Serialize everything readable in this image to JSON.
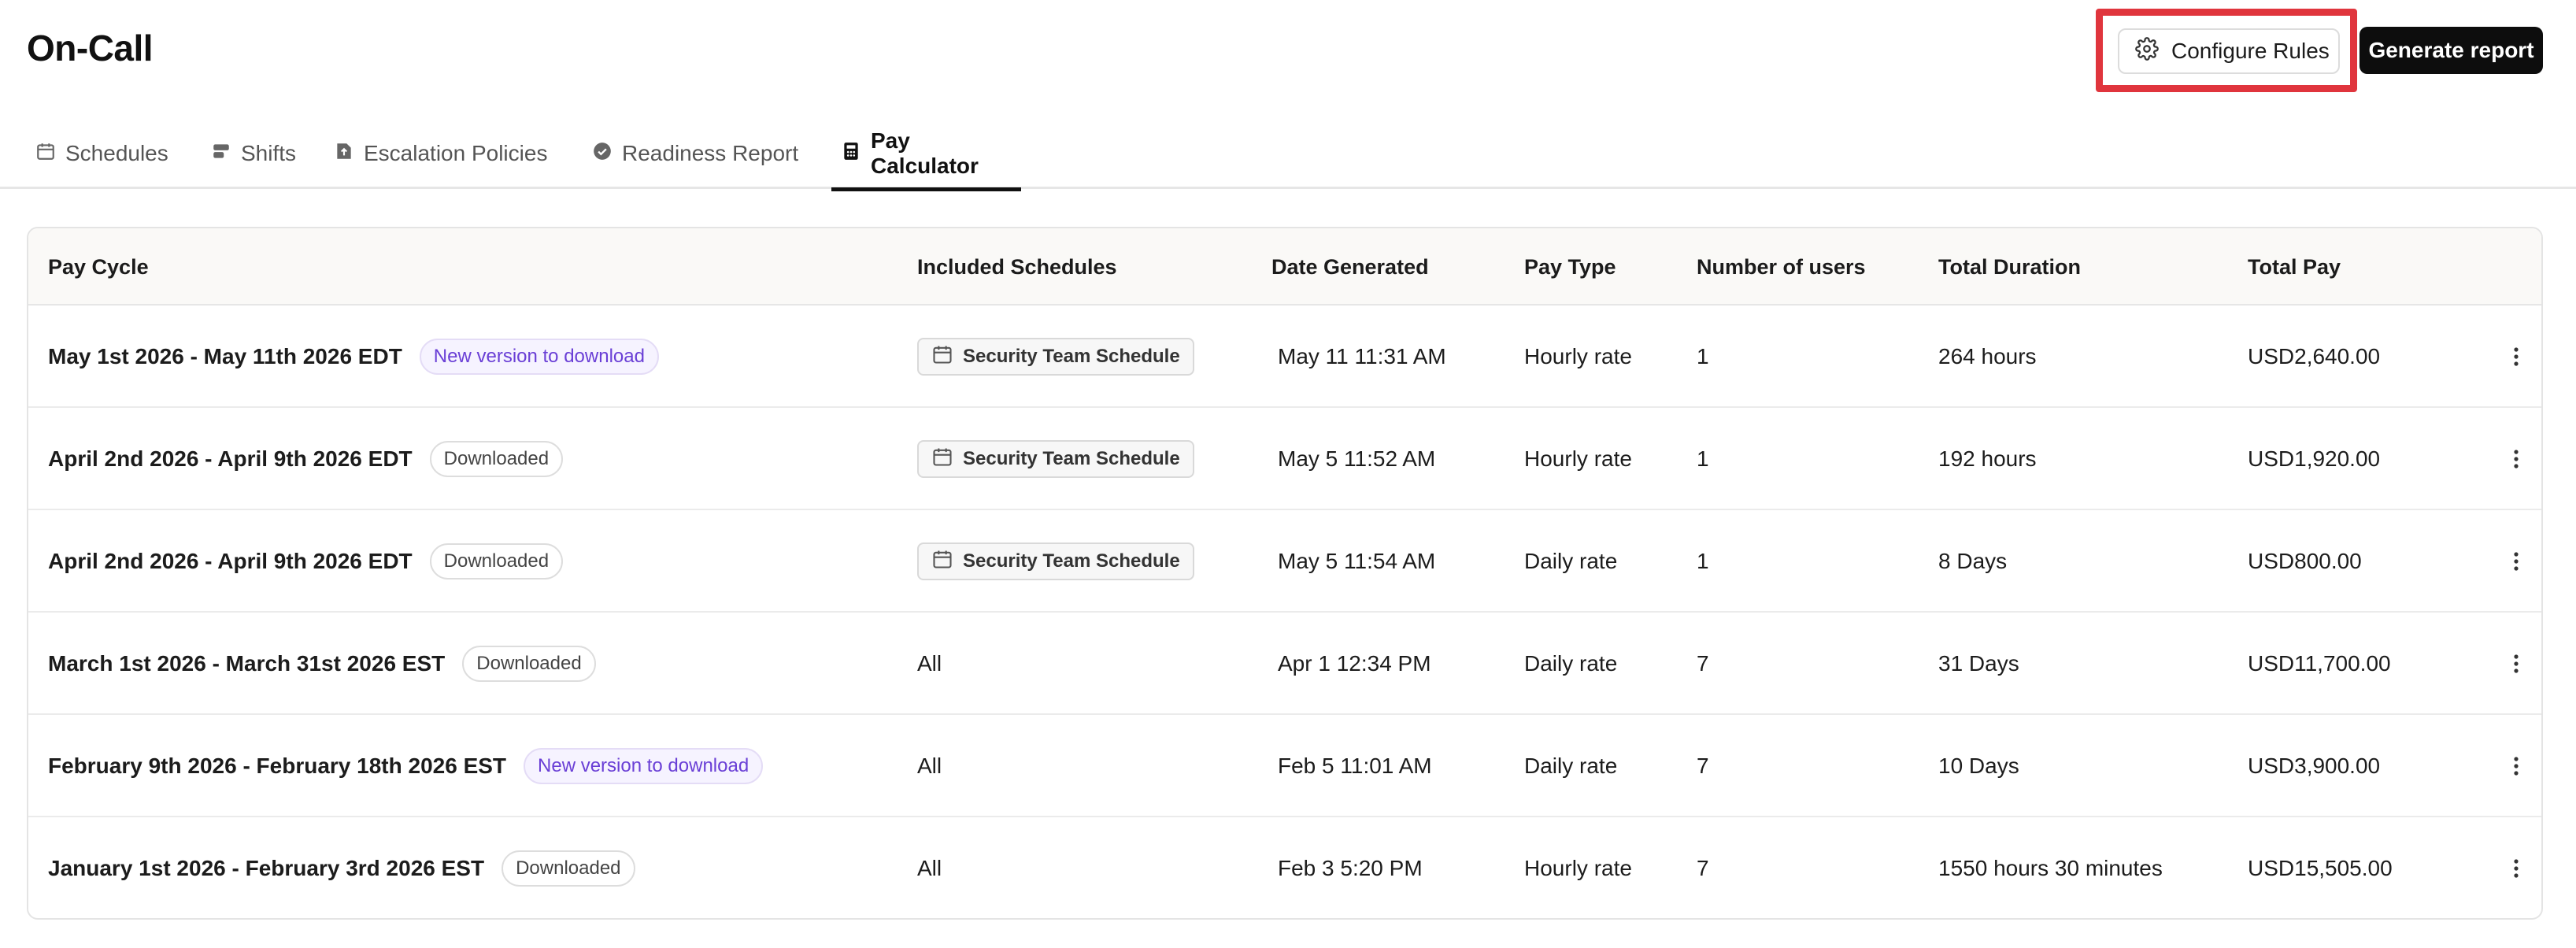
{
  "header": {
    "title": "On-Call",
    "configure_label": "Configure Rules",
    "generate_label": "Generate report"
  },
  "tabs": [
    {
      "label": "Schedules",
      "icon": "calendar-icon"
    },
    {
      "label": "Shifts",
      "icon": "shifts-icon"
    },
    {
      "label": "Escalation Policies",
      "icon": "escalation-icon"
    },
    {
      "label": "Readiness Report",
      "icon": "check-circle-icon"
    },
    {
      "label": "Pay Calculator",
      "icon": "calculator-icon",
      "active": true
    }
  ],
  "table": {
    "columns": [
      "Pay Cycle",
      "Included Schedules",
      "Date Generated",
      "Pay Type",
      "Number of users",
      "Total Duration",
      "Total Pay"
    ],
    "rows": [
      {
        "cycle": "May 1st 2026 - May 11th 2026 EDT",
        "badge": "New version to download",
        "badge_type": "new",
        "schedule": "Security Team Schedule",
        "date": "May 11 11:31 AM",
        "pay_type": "Hourly rate",
        "users": "1",
        "duration": "264 hours",
        "total": "USD2,640.00"
      },
      {
        "cycle": "April 2nd 2026 - April 9th 2026 EDT",
        "badge": "Downloaded",
        "badge_type": "dl",
        "schedule": "Security Team Schedule",
        "date": "May 5 11:52 AM",
        "pay_type": "Hourly rate",
        "users": "1",
        "duration": "192 hours",
        "total": "USD1,920.00"
      },
      {
        "cycle": "April 2nd 2026 - April 9th 2026 EDT",
        "badge": "Downloaded",
        "badge_type": "dl",
        "schedule": "Security Team Schedule",
        "date": "May 5 11:54 AM",
        "pay_type": "Daily rate",
        "users": "1",
        "duration": "8 Days",
        "total": "USD800.00"
      },
      {
        "cycle": "March 1st 2026 - March 31st 2026 EST",
        "badge": "Downloaded",
        "badge_type": "dl",
        "schedule": "All",
        "date": "Apr 1 12:34 PM",
        "pay_type": "Daily rate",
        "users": "7",
        "duration": "31 Days",
        "total": "USD11,700.00"
      },
      {
        "cycle": "February 9th 2026 - February 18th 2026 EST",
        "badge": "New version to download",
        "badge_type": "new",
        "schedule": "All",
        "date": "Feb 5 11:01 AM",
        "pay_type": "Daily rate",
        "users": "7",
        "duration": "10 Days",
        "total": "USD3,900.00"
      },
      {
        "cycle": "January 1st 2026 - February 3rd 2026 EST",
        "badge": "Downloaded",
        "badge_type": "dl",
        "schedule": "All",
        "date": "Feb 3 5:20 PM",
        "pay_type": "Hourly rate",
        "users": "7",
        "duration": "1550 hours 30 minutes",
        "total": "USD15,505.00"
      }
    ]
  },
  "colors": {
    "highlight": "#e0353d",
    "badge_new": "#6a3fd6",
    "primary_button": "#0d0d0d"
  }
}
